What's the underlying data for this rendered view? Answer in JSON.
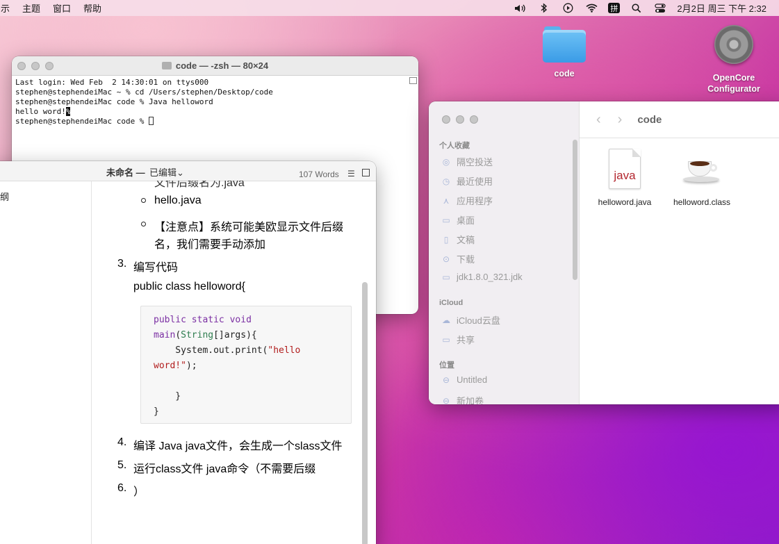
{
  "menubar": {
    "items": [
      "示",
      "主题",
      "窗口",
      "帮助"
    ],
    "clock": "2月2日 周三 下午 2:32",
    "input_method": "拼"
  },
  "desktop": {
    "code_folder": "code",
    "opencore": "OpenCore\nConfigurator",
    "opencore_line1": "OpenCore",
    "opencore_line2": "Configurator"
  },
  "terminal": {
    "title": "code — -zsh — 80×24",
    "lines": [
      "Last login: Wed Feb  2 14:30:01 on ttys000",
      "stephen@stephendeiMac ~ % cd /Users/stephen/Desktop/code",
      "stephen@stephendeiMac code % Java helloword",
      "hello word!",
      "stephen@stephendeiMac code % "
    ],
    "percent": "%"
  },
  "finder": {
    "title": "code",
    "favorites_header": "个人收藏",
    "favorites": [
      "隔空投送",
      "最近使用",
      "应用程序",
      "桌面",
      "文稿",
      "下载",
      "jdk1.8.0_321.jdk"
    ],
    "icloud_header": "iCloud",
    "icloud": [
      "iCloud云盘",
      "共享"
    ],
    "locations_header": "位置",
    "locations": [
      "Untitled",
      "新加卷"
    ],
    "files": [
      "helloword.java",
      "helloword.class"
    ],
    "java_label": "java"
  },
  "editor": {
    "doc_name": "未命名 —",
    "edited": "已编辑⌄",
    "word_count": "107 Words",
    "sidebar_text": "纲",
    "cut_line": "文件后缀名为.java",
    "bullets": [
      "hello.java",
      "【注意点】系统可能美欧显示文件后缀",
      "名，我们需要手动添加"
    ],
    "step3_num": "3.",
    "step3": "编写代码",
    "class_line": "public class helloword{",
    "code": {
      "l1a": "public",
      "l1b": " static",
      "l1c": " void",
      "l2a": "main",
      "l2b": "(",
      "l2c": "String",
      "l2d": "[]args){",
      "l3a": "    System.out.print(",
      "l3b": "\"hello",
      "l4a": "word!\"",
      "l4b": ");",
      "l5": "    }",
      "l6": "}"
    },
    "steps": [
      {
        "num": "4.",
        "text": "编译 Java java文件，会生成一个slass文件"
      },
      {
        "num": "5.",
        "text": "运行class文件 java命令（不需要后缀"
      },
      {
        "num": "6.",
        "text": "）"
      }
    ]
  }
}
